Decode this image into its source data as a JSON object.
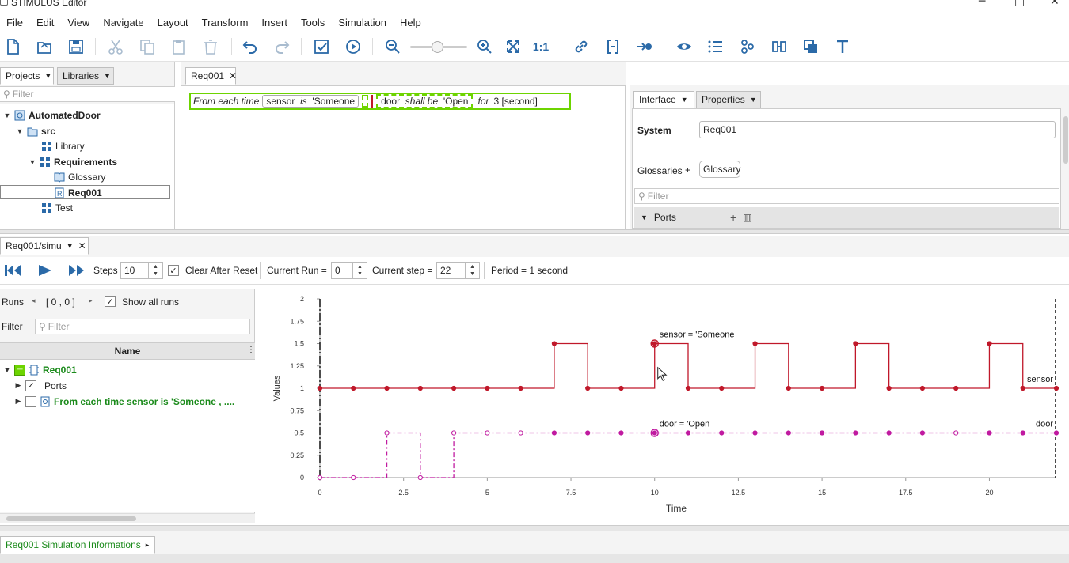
{
  "window": {
    "title": "STIMULUS Editor"
  },
  "menu": [
    "File",
    "Edit",
    "View",
    "Navigate",
    "Layout",
    "Transform",
    "Insert",
    "Tools",
    "Simulation",
    "Help"
  ],
  "toolbar": {
    "zoom_reset_label": "1:1"
  },
  "left_panel": {
    "tabs": [
      {
        "label": "Projects"
      },
      {
        "label": "Libraries"
      }
    ],
    "filter_placeholder": "Filter",
    "tree": [
      {
        "label": "AutomatedDoor"
      },
      {
        "label": "src"
      },
      {
        "label": "Library"
      },
      {
        "label": "Requirements"
      },
      {
        "label": "Glossary"
      },
      {
        "label": "Req001"
      },
      {
        "label": "Test"
      }
    ]
  },
  "editor": {
    "tab": "Req001",
    "requirement": {
      "prefix": "From each time",
      "cond_var": "sensor",
      "cond_op": "is",
      "cond_val": "'Someone",
      "action_var": "door",
      "action_op": "shall be",
      "action_val": "'Open",
      "for_kw": "for",
      "duration": "3 [second]"
    }
  },
  "props_panel": {
    "tabs": [
      {
        "label": "Interface"
      },
      {
        "label": "Properties"
      }
    ],
    "system_label": "System",
    "system_value": "Req001",
    "glossaries_label": "Glossaries",
    "glossaries_add": "+",
    "glossary_chip": "Glossary",
    "filter_placeholder": "Filter",
    "ports_label": "Ports"
  },
  "sim": {
    "tab": "Req001/simu",
    "steps_label": "Steps",
    "steps_value": "10",
    "clear_label": "Clear After Reset",
    "current_run_label": "Current Run =",
    "current_run_value": "0",
    "current_step_label": "Current step =",
    "current_step_value": "22",
    "period_label": "Period = 1 second"
  },
  "runs_panel": {
    "runs_label": "Runs",
    "runs_range": "[ 0 , 0 ]",
    "show_all_label": "Show all runs",
    "filter_label": "Filter",
    "filter_placeholder": "Filter",
    "name_header": "Name",
    "rows": [
      {
        "label": "Req001"
      },
      {
        "label": "Ports"
      },
      {
        "label": "From each time  sensor is  'Someone , ...."
      }
    ]
  },
  "bottom_tab": {
    "label": "Req001 Simulation Informations"
  },
  "chart_data": {
    "type": "line",
    "xlabel": "Time",
    "ylabel": "Values",
    "xlim": [
      0,
      22
    ],
    "ylim": [
      0,
      2
    ],
    "x_ticks": [
      "0",
      "2.5",
      "5",
      "7.5",
      "10",
      "12.5",
      "15",
      "17.5",
      "20"
    ],
    "x_tick_values": [
      0,
      2.5,
      5,
      7.5,
      10,
      12.5,
      15,
      17.5,
      20
    ],
    "y_ticks": [
      "0",
      "0.25",
      "0.5",
      "0.75",
      "1",
      "1.25",
      "1.5",
      "1.75",
      "2"
    ],
    "y_tick_values": [
      0,
      0.25,
      0.5,
      0.75,
      1,
      1.25,
      1.5,
      1.75,
      2
    ],
    "series": [
      {
        "name": "sensor",
        "color": "#c0182a",
        "style": "step",
        "x": [
          0,
          1,
          2,
          3,
          4,
          5,
          6,
          7,
          8,
          9,
          10,
          11,
          12,
          13,
          14,
          15,
          16,
          17,
          18,
          19,
          20,
          21,
          22
        ],
        "values": [
          1,
          1,
          1,
          1,
          1,
          1,
          1,
          1.5,
          1,
          1,
          1.5,
          1,
          1,
          1.5,
          1,
          1,
          1.5,
          1,
          1,
          1,
          1.5,
          1,
          1
        ]
      },
      {
        "name": "door",
        "color": "#c01aa0",
        "style": "step-dashdot",
        "x": [
          0,
          1,
          2,
          3,
          4,
          5,
          6,
          7,
          8,
          9,
          10,
          11,
          12,
          13,
          14,
          15,
          16,
          17,
          18,
          19,
          20,
          21,
          22
        ],
        "values": [
          0,
          0,
          0.5,
          0,
          0.5,
          0.5,
          0.5,
          0.5,
          0.5,
          0.5,
          0.5,
          0.5,
          0.5,
          0.5,
          0.5,
          0.5,
          0.5,
          0.5,
          0.5,
          0.5,
          0.5,
          0.5,
          0.5
        ]
      }
    ],
    "annotations": [
      {
        "text": "sensor = 'Someone",
        "x": 10,
        "y": 1.5
      },
      {
        "text": "door = 'Open",
        "x": 10,
        "y": 0.5
      }
    ],
    "end_labels": [
      "sensor",
      "door"
    ],
    "current_step_x": 22
  }
}
